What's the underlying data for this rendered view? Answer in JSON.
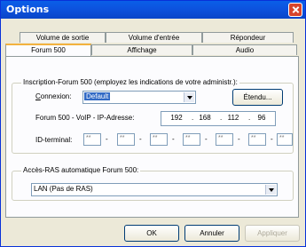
{
  "window": {
    "title": "Options"
  },
  "tabs": {
    "row_top": [
      "Volume de sortie",
      "Volume d'entrée",
      "Répondeur"
    ],
    "row_bottom": [
      "Forum 500",
      "Affichage",
      "Audio"
    ],
    "active": "Forum 500"
  },
  "inscription": {
    "legend": "Inscription-Forum 500 (employez les indications de votre administr.):",
    "connexion_label": "Connexion:",
    "connexion_value": "Default",
    "etendu_button": "Étendu...",
    "ip_label": "Forum 500 - VoIP - IP-Adresse:",
    "ip_octets": [
      "192",
      "168",
      "112",
      "96"
    ],
    "id_label": "ID-terminal:",
    "id_fields": [
      "**",
      "**",
      "**",
      "**",
      "**",
      "**",
      "**"
    ]
  },
  "ras": {
    "legend": "Accès-RAS automatique Forum 500:",
    "value": "LAN (Pas de RAS)"
  },
  "buttons": {
    "ok": "OK",
    "cancel": "Annuler",
    "apply": "Appliquer"
  }
}
